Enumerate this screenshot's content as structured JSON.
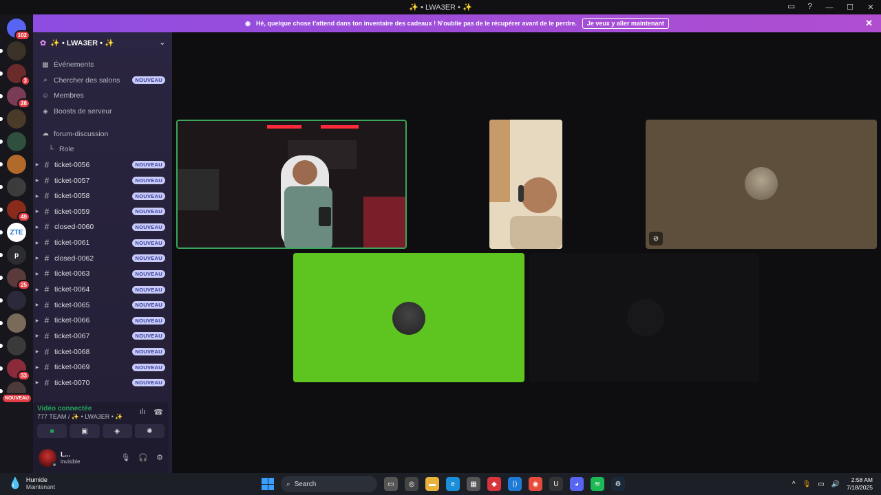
{
  "window": {
    "title": "✨ • LWA3ER • ✨",
    "controls": [
      "—",
      "☐",
      "✕"
    ]
  },
  "banner": {
    "text": "Hé, quelque chose t'attend dans ton inventaire des cadeaux ! N'oublie pas de le récupérer avant de le perdre.",
    "cta": "Je veux y aller maintenant"
  },
  "server_rail": [
    {
      "label": "",
      "badge": "102",
      "bg": "#5865f2"
    },
    {
      "label": "",
      "badge": "",
      "bg": "#3a3226"
    },
    {
      "label": "",
      "badge": "3",
      "bg": "#6b2b2b"
    },
    {
      "label": "",
      "badge": "28",
      "bg": "#7a3b56"
    },
    {
      "label": "",
      "badge": "",
      "bg": "#4a3a2a"
    },
    {
      "label": "",
      "badge": "",
      "bg": "#2f4f3f"
    },
    {
      "label": "",
      "badge": "",
      "bg": "#b26a2a"
    },
    {
      "label": "",
      "badge": "",
      "bg": "#3c3c3c"
    },
    {
      "label": "",
      "badge": "49",
      "bg": "#8a2a1a"
    },
    {
      "label": "ZTE",
      "badge": "",
      "bg": "#ffffff"
    },
    {
      "label": "p",
      "badge": "",
      "bg": "#2b2d31"
    },
    {
      "label": "",
      "badge": "25",
      "bg": "#5a3a3a"
    },
    {
      "label": "",
      "badge": "",
      "bg": "#2a2a3a"
    },
    {
      "label": "",
      "badge": "",
      "bg": "#7a6a5a"
    },
    {
      "label": "",
      "badge": "",
      "bg": "#3a3a3a"
    },
    {
      "label": "",
      "badge": "33",
      "bg": "#8a2a3a"
    },
    {
      "label": "",
      "badge": "NOUVEAU",
      "bg": "#4a3a3a"
    }
  ],
  "guild": {
    "name": "✨ • LWA3ER • ✨"
  },
  "nav": [
    {
      "icon": "calendar",
      "label": "Événements",
      "new": ""
    },
    {
      "icon": "search",
      "label": "Chercher des salons",
      "new": "NOUVEAU"
    },
    {
      "icon": "members",
      "label": "Membres",
      "new": ""
    },
    {
      "icon": "boost",
      "label": "Boosts de serveur",
      "new": ""
    }
  ],
  "forum": {
    "label": "forum-discussion",
    "thread": "Role"
  },
  "new_label": "NOUVEAU",
  "channels": [
    "ticket-0056",
    "ticket-0057",
    "ticket-0058",
    "ticket-0059",
    "closed-0060",
    "ticket-0061",
    "closed-0062",
    "ticket-0063",
    "ticket-0064",
    "ticket-0065",
    "ticket-0066",
    "ticket-0067",
    "ticket-0068",
    "ticket-0069",
    "ticket-0070"
  ],
  "voice": {
    "status": "Vidéo connectée",
    "channel": "777 TEAM / ✨ • LWA3ER • ✨"
  },
  "user": {
    "name": "L...",
    "status": "invisible"
  },
  "taskbar": {
    "weather_title": "Humide",
    "weather_sub": "Maintenant",
    "search": "Search",
    "time": "2:58 AM",
    "date": "7/18/2025"
  },
  "colors": {
    "accent": "#5865f2",
    "voice_green": "#23a55a",
    "active_tile_border": "#3ba55d",
    "green_screen": "#5ec520"
  }
}
